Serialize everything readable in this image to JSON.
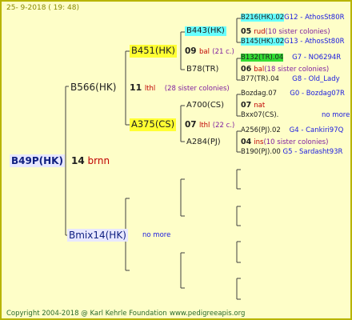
{
  "header": "25-  9-2018 (  19:  48)",
  "footer": {
    "copyright": "Copyright 2004-2018 @ Karl Kehrle Foundation",
    "site": "www.pedigreeapis.org"
  },
  "colors": {
    "page_bg": "#fefec8",
    "border": "#b8b400",
    "yellow_box": "#ffff33",
    "cyan_box": "#66ffff",
    "green_box": "#33dd33",
    "lavender_box": "#e8e8ff"
  },
  "root": {
    "id": "B49P(HK)",
    "year": "14",
    "breeder": "brnn"
  },
  "sire": {
    "id": "B566(HK)",
    "year": "11",
    "breeder": "lthl",
    "sisters": "(28 sister colonies)"
  },
  "dam": {
    "id": "Bmix14(HK)",
    "more": "no more"
  },
  "ss": {
    "id": "B451(HK)",
    "year": "09",
    "breeder": "bal",
    "sisters": "(21 c.)"
  },
  "sd": {
    "id": "A375(CS)",
    "year": "07",
    "breeder": "lthl",
    "sisters": "(22 c.)"
  },
  "sss": {
    "id": "B443(HK)",
    "year": "05",
    "breeder": "rud",
    "sisters": "(10 sister colonies)"
  },
  "ssd": {
    "id": "B78(TR)",
    "year": "06",
    "breeder": "bal",
    "sisters": "(18 sister colonies)"
  },
  "sds": {
    "id": "A700(CS)",
    "year": "07",
    "breeder": "nat"
  },
  "sdd": {
    "id": "A284(PJ)",
    "year": "04",
    "breeder": "ins",
    "sisters": "(10 sister colonies)"
  },
  "gen5": [
    {
      "id": "B216(HK).02",
      "gen": "G12",
      "name": "AthosSt80R"
    },
    {
      "id": "B145(HK).02",
      "gen": "G13",
      "name": "AthosSt80R"
    },
    {
      "id": "B132(TR).04",
      "gen": "G7",
      "name": "NO6294R"
    },
    {
      "id": "B77(TR).04",
      "gen": "G8",
      "name": "Old_Lady"
    },
    {
      "id": "Bozdag.07",
      "gen": "G0",
      "name": "Bozdag07R"
    },
    {
      "id": "Bxx07(CS).",
      "more": "no more"
    },
    {
      "id": "A256(PJ).02",
      "gen": "G4",
      "name": "Cankiri97Q"
    },
    {
      "id": "B190(PJ).00",
      "gen": "G5",
      "name": "Sardasht93R"
    }
  ]
}
